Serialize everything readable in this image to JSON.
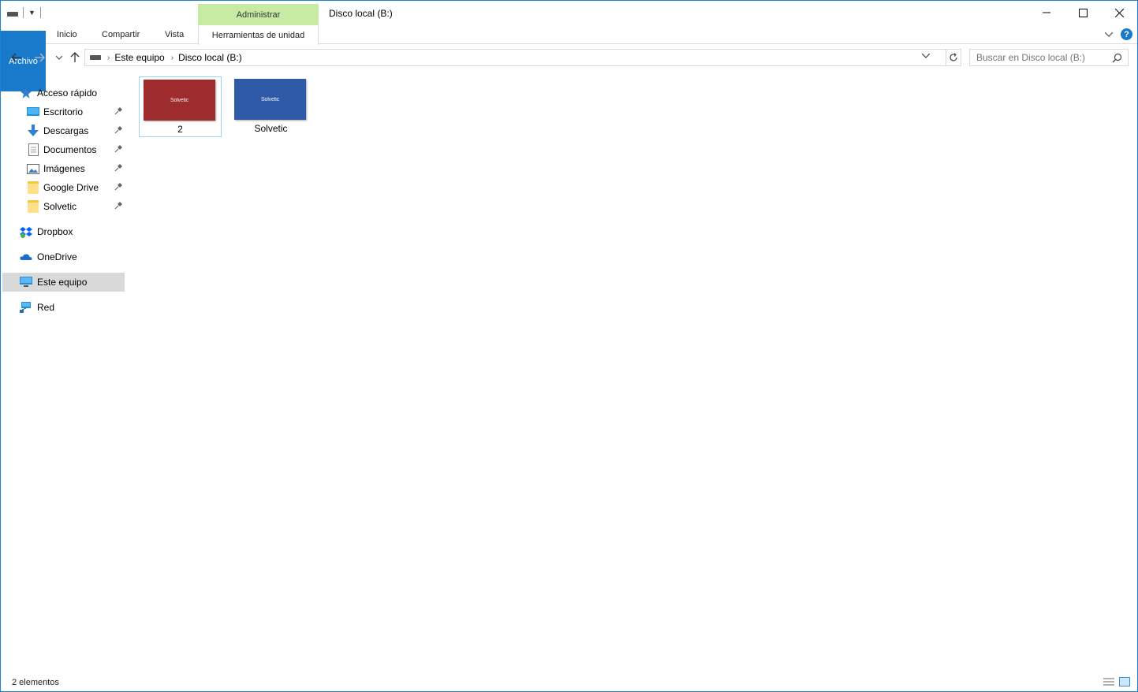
{
  "window": {
    "title": "Disco local (B:)",
    "context_tab_group": "Administrar",
    "controls": {
      "minimize": "minimize",
      "maximize": "maximize",
      "close": "close"
    }
  },
  "ribbon": {
    "tabs": [
      {
        "label": "Archivo",
        "accent": "#1979ca"
      },
      {
        "label": "Inicio"
      },
      {
        "label": "Compartir"
      },
      {
        "label": "Vista"
      },
      {
        "label": "Herramientas de unidad"
      }
    ],
    "help": "?"
  },
  "address": {
    "crumbs": [
      "Este equipo",
      "Disco local (B:)"
    ],
    "search_placeholder": "Buscar en Disco local (B:)"
  },
  "nav": {
    "quick_access": "Acceso rápido",
    "quick_items": [
      {
        "label": "Escritorio",
        "icon": "desktop-icon"
      },
      {
        "label": "Descargas",
        "icon": "download-icon"
      },
      {
        "label": "Documentos",
        "icon": "documents-icon"
      },
      {
        "label": "Imágenes",
        "icon": "pictures-icon"
      },
      {
        "label": "Google Drive",
        "icon": "folder-icon"
      },
      {
        "label": "Solvetic",
        "icon": "folder-icon"
      }
    ],
    "dropbox": "Dropbox",
    "onedrive": "OneDrive",
    "this_pc": "Este equipo",
    "network": "Red"
  },
  "files": [
    {
      "name": "2",
      "thumb_color": "#9e2b2e",
      "thumb_text": "Solvetic"
    },
    {
      "name": "Solvetic",
      "thumb_color": "#2f5aa8",
      "thumb_text": "Solvetic"
    }
  ],
  "status": {
    "count": "2 elementos"
  }
}
